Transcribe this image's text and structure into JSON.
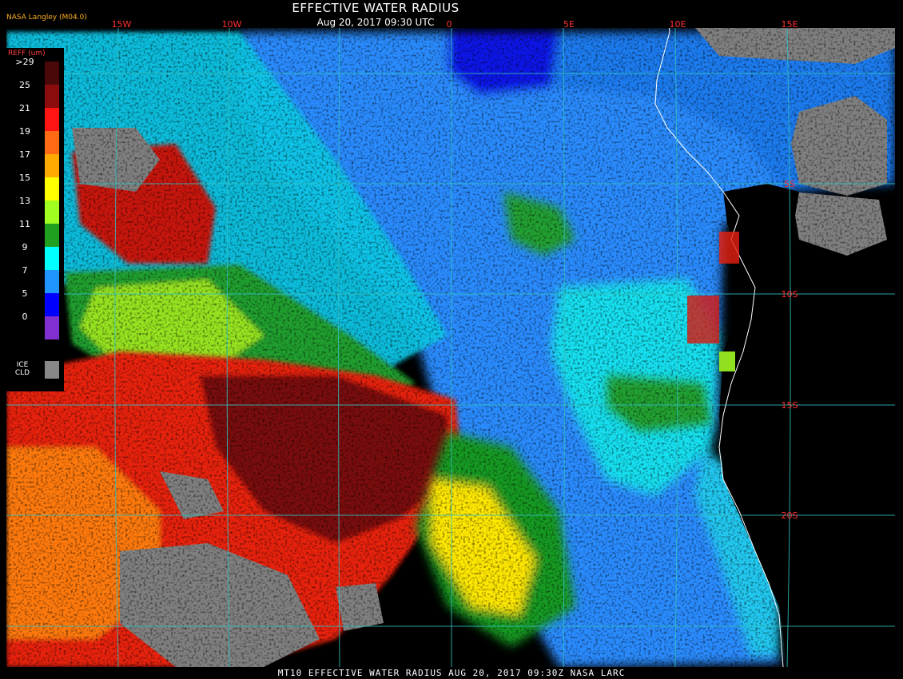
{
  "header": {
    "title": "EFFECTIVE WATER RADIUS",
    "subtitle": "Aug 20, 2017 09:30 UTC",
    "producer": "NASA Langley (M04.0)"
  },
  "footer": {
    "caption": "MT10  EFFECTIVE WATER RADIUS   AUG 20, 2017 09:30Z   NASA LARC"
  },
  "legend": {
    "title": "REFF (um)",
    "levels": [
      {
        "label": ">29",
        "color": "#4a0808"
      },
      {
        "label": "25",
        "color": "#8b0c0c"
      },
      {
        "label": "21",
        "color": "#ff1414"
      },
      {
        "label": "19",
        "color": "#ff6a14"
      },
      {
        "label": "17",
        "color": "#ffaa00"
      },
      {
        "label": "15",
        "color": "#ffff00"
      },
      {
        "label": "13",
        "color": "#a0ff20"
      },
      {
        "label": "11",
        "color": "#20a020"
      },
      {
        "label": "9",
        "color": "#00ffff"
      },
      {
        "label": "7",
        "color": "#2094ff"
      },
      {
        "label": "5",
        "color": "#0000ff"
      },
      {
        "label": "0",
        "color": "#8030d0"
      }
    ],
    "ice_label_1": "ICE",
    "ice_label_2": "CLD",
    "ice_color": "#888888"
  },
  "grid": {
    "lon_labels": [
      "15W",
      "10W",
      "0",
      "5E",
      "10E",
      "15E"
    ],
    "lat_labels": [
      "5S",
      "10S",
      "15S",
      "20S"
    ],
    "grid_color": "#30c0c0",
    "label_color": "#ff3030"
  },
  "colors": {
    "land_no_cloud": "#000000",
    "clear_ocean": "#000000",
    "coast": "#ffffff"
  }
}
